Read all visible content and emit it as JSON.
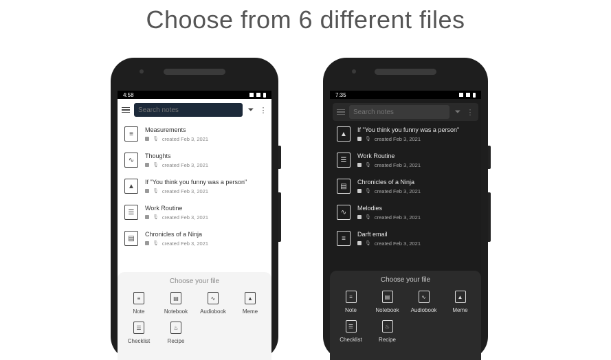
{
  "headline": "Choose from 6 different files",
  "left_phone": {
    "status_time": "4:58",
    "search_placeholder": "Search notes",
    "notes": [
      {
        "title": "Measurements",
        "sub": "created Feb 3, 2021",
        "icon": "note-icon"
      },
      {
        "title": "Thoughts",
        "sub": "created Feb 3, 2021",
        "icon": "audiobook-icon"
      },
      {
        "title": "If \"You think you funny was a person\"",
        "sub": "created Feb 3, 2021",
        "icon": "meme-icon"
      },
      {
        "title": "Work Routine",
        "sub": "created Feb 3, 2021",
        "icon": "checklist-icon"
      },
      {
        "title": "Chronicles of a Ninja",
        "sub": "created Feb 3, 2021",
        "icon": "notebook-icon"
      }
    ],
    "sheet_title": "Choose your file",
    "file_types": [
      "Note",
      "Notebook",
      "Audiobook",
      "Meme",
      "Checklist",
      "Recipe"
    ]
  },
  "right_phone": {
    "status_time": "7:35",
    "search_placeholder": "Search notes",
    "notes": [
      {
        "title": "If \"You think you funny was a person\"",
        "sub": "created Feb 3, 2021",
        "icon": "meme-icon"
      },
      {
        "title": "Work Routine",
        "sub": "created Feb 3, 2021",
        "icon": "checklist-icon"
      },
      {
        "title": "Chronicles of a Ninja",
        "sub": "created Feb 3, 2021",
        "icon": "notebook-icon"
      },
      {
        "title": "Melodies",
        "sub": "created Feb 3, 2021",
        "icon": "audiobook-icon"
      },
      {
        "title": "Darft email",
        "sub": "created Feb 3, 2021",
        "icon": "note-icon"
      }
    ],
    "sheet_title": "Choose your file",
    "file_types": [
      "Note",
      "Notebook",
      "Audiobook",
      "Meme",
      "Checklist",
      "Recipe"
    ]
  }
}
